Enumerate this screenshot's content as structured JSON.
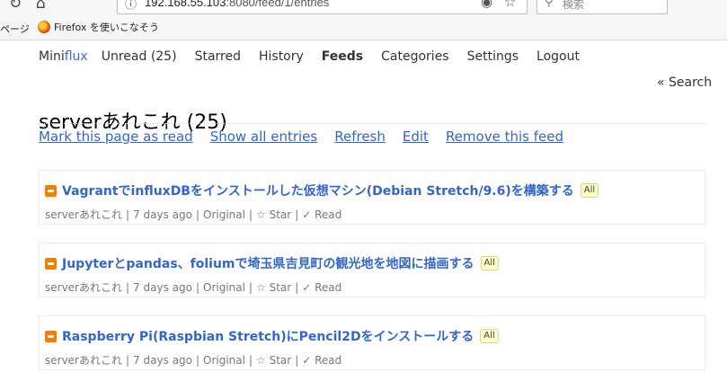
{
  "browser": {
    "url_host": "192.168.55.103",
    "url_path": ":8080/feed/1/entries",
    "search_placeholder": "検索",
    "bookmark_page": "ページ",
    "bookmark_firefox": "Firefox を使いこなそう"
  },
  "nav": {
    "logo_mini": "Mini",
    "logo_flux": "flux",
    "unread": "Unread (25)",
    "starred": "Starred",
    "history": "History",
    "feeds": "Feeds",
    "categories": "Categories",
    "settings": "Settings",
    "logout": "Logout",
    "search": "« Search"
  },
  "page": {
    "title": "serverあれこれ (25)"
  },
  "actions": {
    "mark_read": "Mark this page as read",
    "show_all": "Show all entries",
    "refresh": "Refresh",
    "edit": "Edit",
    "remove": "Remove this feed"
  },
  "entries": [
    {
      "title": "VagrantでinfluxDBをインストールした仮想マシン(Debian Stretch/9.6)を構築する",
      "badge": "All",
      "feed": "serverあれこれ",
      "age": "7 days ago",
      "original": "Original",
      "star": "☆ Star",
      "read": "✓ Read"
    },
    {
      "title": "Jupyterとpandas、foliumで埼玉県吉見町の観光地を地図に描画する",
      "badge": "All",
      "feed": "serverあれこれ",
      "age": "7 days ago",
      "original": "Original",
      "star": "☆ Star",
      "read": "✓ Read"
    },
    {
      "title": "Raspberry Pi(Raspbian Stretch)にPencil2Dをインストールする",
      "badge": "All",
      "feed": "serverあれこれ",
      "age": "7 days ago",
      "original": "Original",
      "star": "☆ Star",
      "read": "✓ Read"
    }
  ]
}
